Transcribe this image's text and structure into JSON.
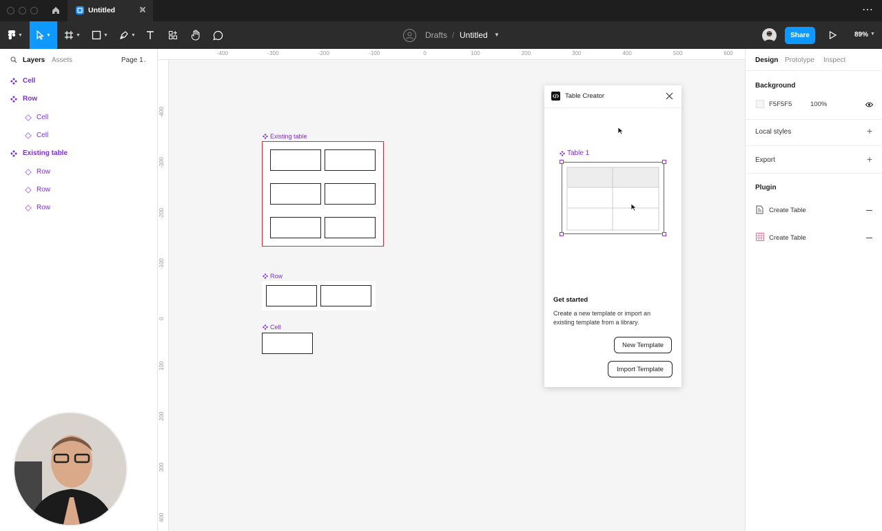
{
  "titlebar": {
    "tab_title": "Untitled",
    "add_tab": "+",
    "more": "⋯"
  },
  "toolbar": {
    "breadcrumb_folder": "Drafts",
    "breadcrumb_sep": "/",
    "file_name": "Untitled",
    "share_label": "Share",
    "zoom": "89%",
    "accent": "#0d99ff"
  },
  "left_panel": {
    "tabs": [
      "Layers",
      "Assets"
    ],
    "page": "Page 1",
    "layers": [
      {
        "name": "Cell",
        "kind": "component",
        "indent": 0
      },
      {
        "name": "Row",
        "kind": "component",
        "indent": 0
      },
      {
        "name": "Cell",
        "kind": "instance",
        "indent": 1
      },
      {
        "name": "Cell",
        "kind": "instance",
        "indent": 1
      },
      {
        "name": "Existing table",
        "kind": "component",
        "indent": 0
      },
      {
        "name": "Row",
        "kind": "instance",
        "indent": 1
      },
      {
        "name": "Row",
        "kind": "instance",
        "indent": 1
      },
      {
        "name": "Row",
        "kind": "instance",
        "indent": 1
      }
    ]
  },
  "right_panel": {
    "tabs": [
      "Design",
      "Prototype",
      "Inspect"
    ],
    "background_label": "Background",
    "bg_hex": "F5F5F5",
    "bg_opacity": "100%",
    "local_styles": "Local styles",
    "export": "Export",
    "plugin_label": "Plugin",
    "plugins": [
      "Create Table",
      "Create Table"
    ]
  },
  "canvas": {
    "ruler_h": [
      "-400",
      "-300",
      "-200",
      "-100",
      "0",
      "100",
      "200",
      "300",
      "400",
      "500",
      "600"
    ],
    "ruler_v": [
      "-400",
      "-300",
      "-200",
      "-100",
      "0",
      "100",
      "200",
      "300",
      "400"
    ],
    "frames": {
      "existing_table": "Existing table",
      "row": "Row",
      "cell": "Cell"
    },
    "component_color": "#7b2fd6",
    "selection_color": "#e0282e"
  },
  "plugin": {
    "title": "Table Creator",
    "preview_label": "Table 1",
    "heading": "Get started",
    "description": "Create a new template or import an existing template from a library.",
    "new_template": "New Template",
    "import_template": "Import Template"
  },
  "help": "?"
}
